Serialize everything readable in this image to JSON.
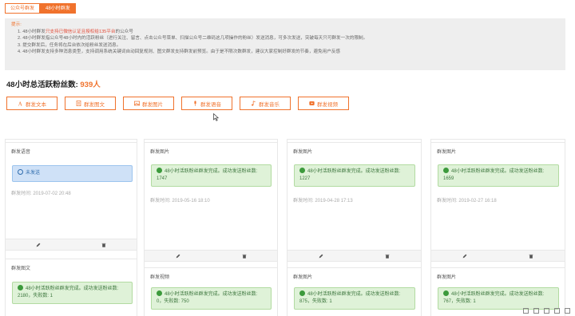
{
  "tabs": [
    "公众号群发",
    "48小时群发"
  ],
  "tips": {
    "title": "提示:",
    "lines": [
      {
        "pre": "1. 48小时群发",
        "red": "只支持已微信认证且授权给135平台",
        "post": "的公众号"
      },
      {
        "pre": "2. 48小时群发指公众号48小时内的活跃粉丝（进行关注、留言、点击公众号菜单、扫描公众号二维码这几项操作的粉丝）发送消息，可多次发送，突破每天只可群发一次的限制。",
        "red": "",
        "post": ""
      },
      {
        "pre": "3. 提交群发后，任务将在后台依次给粉丝发送消息。",
        "red": "",
        "post": ""
      },
      {
        "pre": "4. 48小时群发支持多种消息类型，支持调用系统关键词自动回复规则、图文群发支持群发前预览。由于是不限次数群发，建议大家控制好群发的节奏，避免用户反感",
        "red": "",
        "post": ""
      }
    ]
  },
  "fans": {
    "label": "48小时总活跃粉丝数:",
    "value": "939人"
  },
  "actions": [
    {
      "label": "群发文本",
      "icon": "text-icon"
    },
    {
      "label": "群发图文",
      "icon": "article-icon"
    },
    {
      "label": "群发图片",
      "icon": "image-icon"
    },
    {
      "label": "群发语音",
      "icon": "microphone-icon"
    },
    {
      "label": "群发音乐",
      "icon": "music-icon"
    },
    {
      "label": "群发视频",
      "icon": "video-icon"
    }
  ],
  "cards": [
    {
      "type": "群发语音",
      "status": "未发送",
      "style": "blue",
      "time": "群发时间: 2019-07-02 20:48"
    },
    {
      "type": "群发图片",
      "status": "48小时活跃粉丝群发完成。成功发送粉丝数: 1747",
      "style": "green",
      "time": "群发时间: 2019-05-16 18:10"
    },
    {
      "type": "群发图片",
      "status": "48小时活跃粉丝群发完成。成功发送粉丝数: 1227",
      "style": "green",
      "time": "群发时间: 2019-04-28 17:13"
    },
    {
      "type": "群发图片",
      "status": "48小时活跃粉丝群发完成。成功发送粉丝数: 1659",
      "style": "green",
      "time": "群发时间: 2019-02-27 16:18"
    },
    {
      "type": "群发图文",
      "status": "48小时活跃粉丝群发完成。成功发送粉丝数: 2180，失败数: 1",
      "style": "green",
      "time": ""
    },
    {
      "type": "群发视频",
      "status": "48小时活跃粉丝群发完成。成功发送粉丝数: 0，失败数: 750",
      "style": "green",
      "time": ""
    },
    {
      "type": "群发图片",
      "status": "48小时活跃粉丝群发完成。成功发送粉丝数: 875，失败数: 1",
      "style": "green",
      "time": ""
    },
    {
      "type": "群发图片",
      "status": "48小时活跃粉丝群发完成。成功发送粉丝数: 767，失败数: 1",
      "style": "green",
      "time": ""
    }
  ]
}
